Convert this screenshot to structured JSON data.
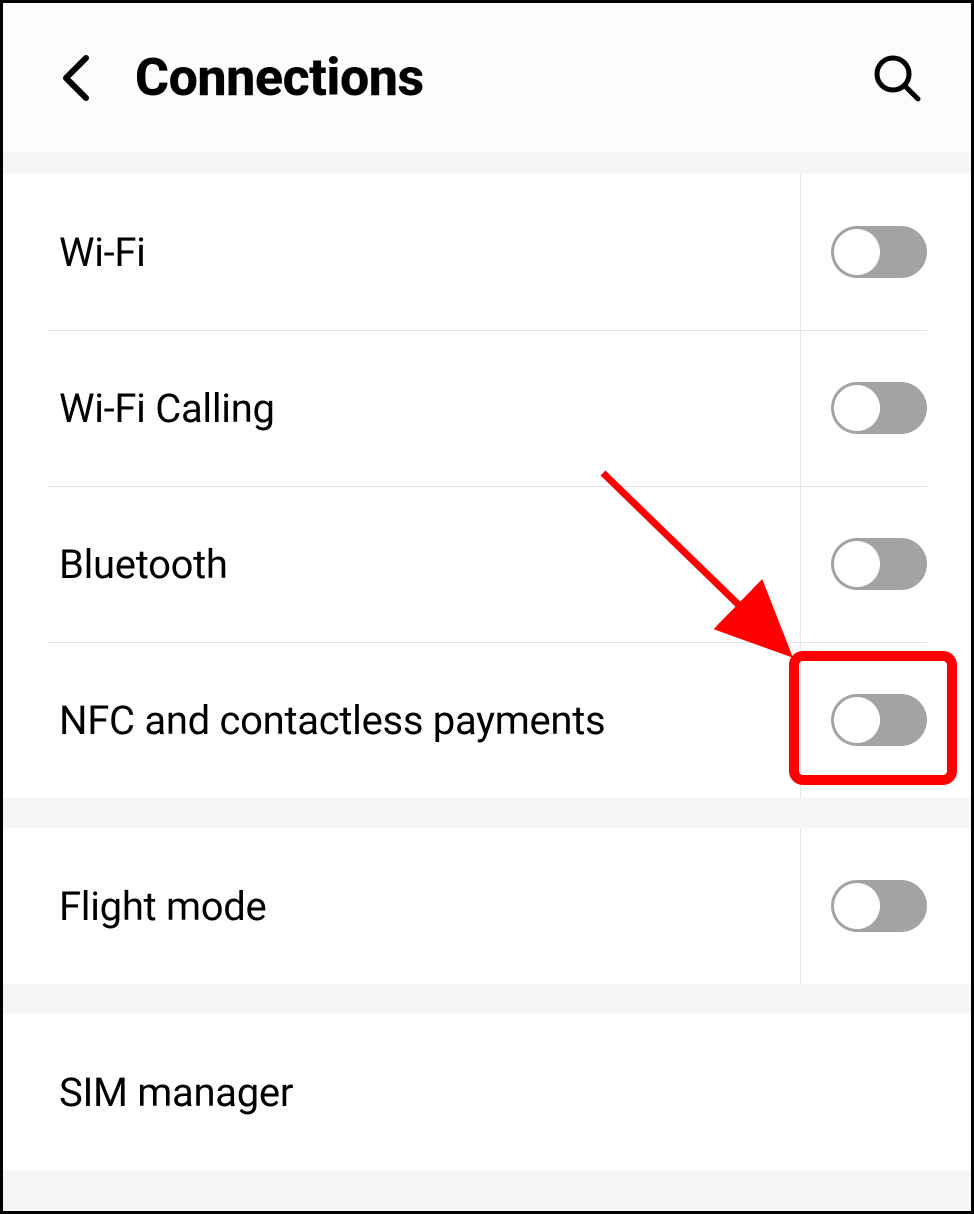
{
  "header": {
    "title": "Connections"
  },
  "groups": [
    {
      "rows": [
        {
          "id": "wifi",
          "label": "Wi-Fi",
          "hasToggle": true,
          "toggleOn": false
        },
        {
          "id": "wifi-calling",
          "label": "Wi-Fi Calling",
          "hasToggle": true,
          "toggleOn": false
        },
        {
          "id": "bluetooth",
          "label": "Bluetooth",
          "hasToggle": true,
          "toggleOn": false
        },
        {
          "id": "nfc",
          "label": "NFC and contactless payments",
          "hasToggle": true,
          "toggleOn": false
        }
      ]
    },
    {
      "rows": [
        {
          "id": "flight-mode",
          "label": "Flight mode",
          "hasToggle": true,
          "toggleOn": false
        }
      ]
    },
    {
      "rows": [
        {
          "id": "sim-manager",
          "label": "SIM manager",
          "hasToggle": false
        }
      ]
    }
  ],
  "annotation": {
    "highlight_target": "nfc-toggle",
    "arrow_color": "#ff0000"
  }
}
